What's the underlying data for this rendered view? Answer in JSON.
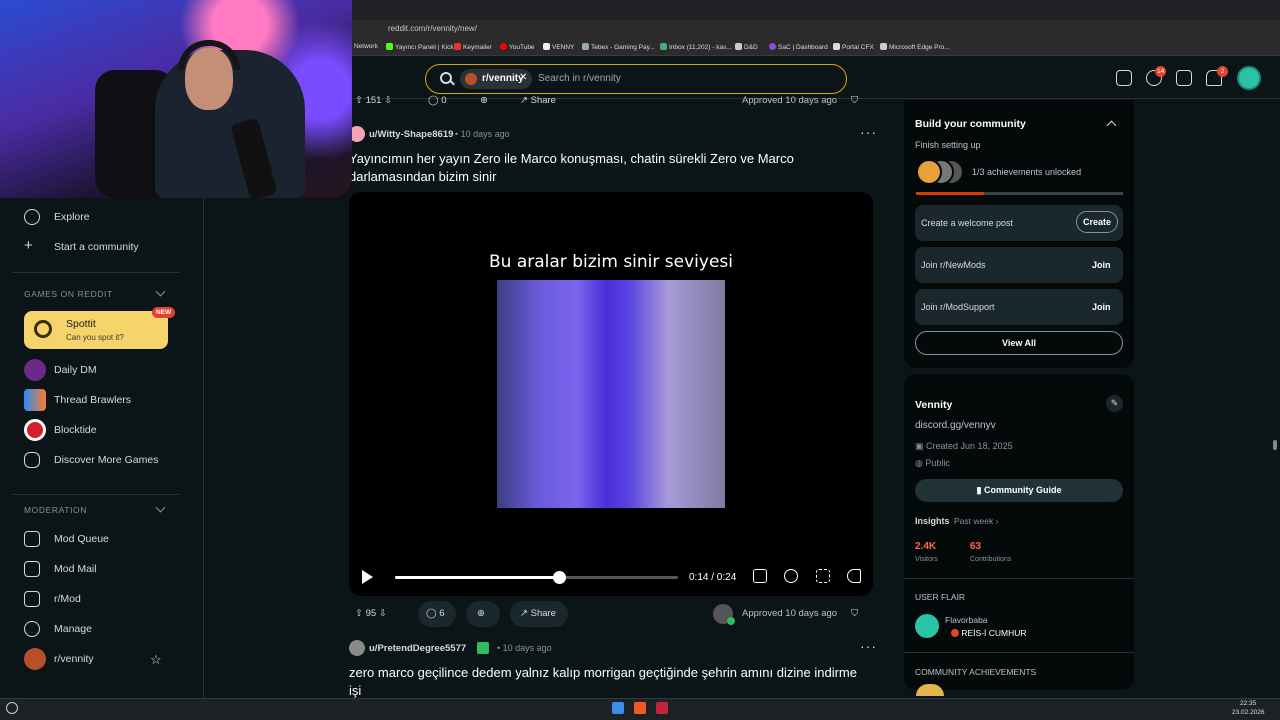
{
  "browser": {
    "url": "reddit.com/r/vennity/new/",
    "bookmarks": [
      "Network",
      "Yayıncı Paneli | Kick",
      "Keymailer",
      "YouTube",
      "VENNY",
      "Tebex - Gaming Pay...",
      "Inbox (11,202) - kas...",
      "D&D",
      "SaC | Dashboard",
      "Portal CFX",
      "Microsoft Edge Pro..."
    ]
  },
  "header": {
    "subreddit_chip": "r/vennity",
    "search_placeholder": "Search in r/vennity",
    "chat_badge": "14",
    "notif_badge": "2"
  },
  "sidebar": {
    "explore": "Explore",
    "start_community": "Start a community",
    "games_header": "GAMES ON REDDIT",
    "spottit": {
      "title": "Spottit",
      "subtitle": "Can you spot it?",
      "badge": "NEW"
    },
    "games": [
      "Daily DM",
      "Thread Brawlers",
      "Blocktide",
      "Discover More Games"
    ],
    "moderation_header": "MODERATION",
    "mod_items": [
      "Mod Queue",
      "Mod Mail",
      "r/Mod",
      "Manage",
      "r/vennity"
    ]
  },
  "prev_post_actions": {
    "votes": "151",
    "comments": "0",
    "share": "Share",
    "approved": "Approved 10 days ago"
  },
  "post": {
    "author": "u/Witty-Shape8619",
    "time": "• 10 days ago",
    "title": "Yayıncımın her yayın Zero ile Marco konuşması, chatin sürekli Zero ve Marco darlamasından bizim sinir",
    "video_caption": "Bu aralar bizim sinir seviyesi",
    "video_time": "0:14 / 0:24",
    "video_progress": 0.58,
    "votes": "95",
    "comments": "6",
    "share": "Share",
    "approved": "Approved 10 days ago"
  },
  "next_post": {
    "author": "u/PretendDegree5577",
    "time": "• 10 days ago",
    "title": "zero marco geçilince dedem yalnız kalıp morrigan geçtiğinde şehrin amını dizine indirme işi"
  },
  "build_card": {
    "title": "Build your community",
    "subtitle": "Finish setting up",
    "achievements": "1/3 achievements unlocked",
    "progress": 0.33,
    "tasks": [
      {
        "label": "Create a welcome post",
        "button": "Create"
      },
      {
        "label": "Join r/NewMods",
        "button": "Join"
      },
      {
        "label": "Join r/ModSupport",
        "button": "Join"
      }
    ],
    "view_all": "View All"
  },
  "about_card": {
    "name": "Vennity",
    "description": "discord.gg/vennyv",
    "created": "Created Jun 18, 2025",
    "visibility": "Public",
    "guide": "Community Guide",
    "insights_label": "Insights",
    "insights_range": "Past week",
    "visitors_num": "2.4K",
    "visitors_lbl": "Visitors",
    "contrib_num": "63",
    "contrib_lbl": "Contributions",
    "user_flair_header": "USER FLAIR",
    "flair_user": "Flavorbaba",
    "flair_text": "REİS-İ CUMHUR",
    "achievements_header": "COMMUNITY ACHIEVEMENTS"
  },
  "taskbar": {
    "time": "22:35",
    "date": "23.02.2026"
  },
  "colors": {
    "accent": "#d93a00",
    "stat": "#ff6a3d",
    "approved": "#2dbd60"
  }
}
